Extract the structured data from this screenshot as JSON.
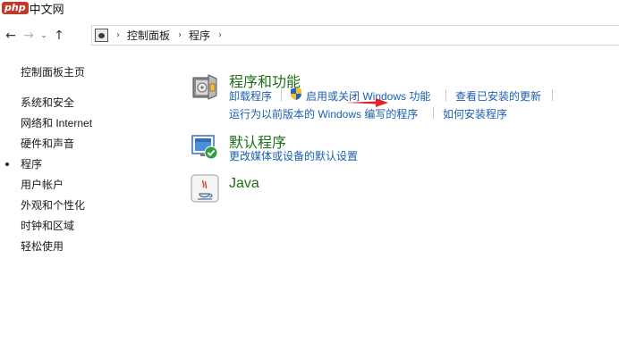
{
  "watermark": {
    "logo": "php",
    "text": "中文网"
  },
  "nav": {
    "back_icon": "←",
    "forward_icon": "→",
    "recent_icon": "⌄",
    "up_icon": "↑"
  },
  "address": {
    "sep": "›",
    "crumbs": [
      "控制面板",
      "程序"
    ]
  },
  "sidebar": {
    "items": [
      {
        "label": "控制面板主页"
      },
      {
        "label": "系统和安全"
      },
      {
        "label": "网络和 Internet"
      },
      {
        "label": "硬件和声音"
      },
      {
        "label": "程序"
      },
      {
        "label": "用户帐户"
      },
      {
        "label": "外观和个性化"
      },
      {
        "label": "时钟和区域"
      },
      {
        "label": "轻松使用"
      }
    ],
    "selected_index": 4
  },
  "main": {
    "programs": {
      "title": "程序和功能",
      "links": {
        "uninstall": "卸载程序",
        "windows_features": "启用或关闭 Windows 功能",
        "view_updates": "查看已安装的更新",
        "compat": "运行为以前版本的 Windows 编写的程序",
        "how_install": "如何安装程序"
      }
    },
    "defaults": {
      "title": "默认程序",
      "links": {
        "change_defaults": "更改媒体或设备的默认设置"
      }
    },
    "java": {
      "title": "Java"
    }
  },
  "colors": {
    "title_green": "#1e6e18",
    "link_blue": "#1c5fb2",
    "annotation_red": "#e0242a"
  }
}
